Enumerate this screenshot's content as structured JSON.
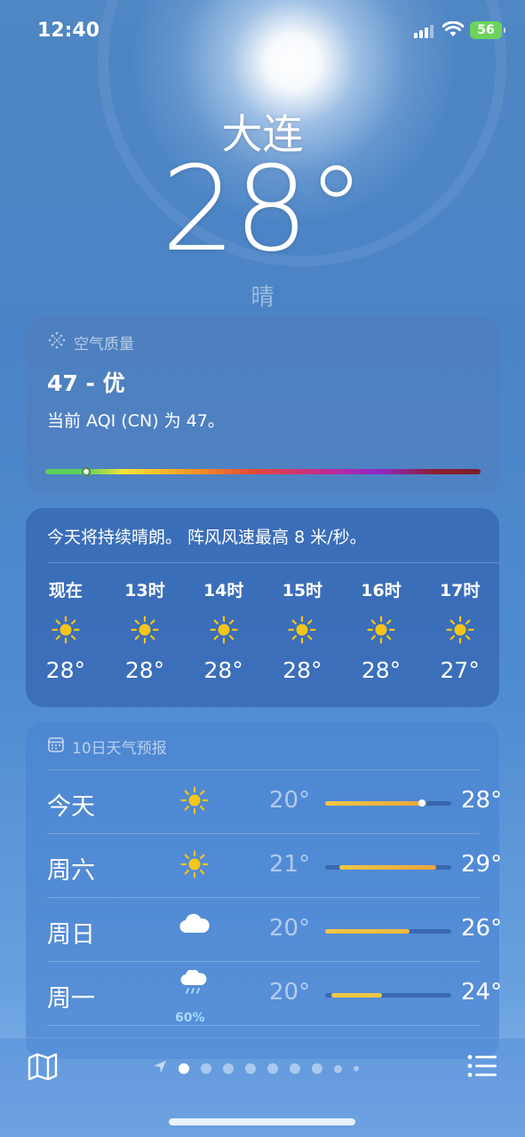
{
  "status_bar": {
    "time": "12:40",
    "battery": "56"
  },
  "location": {
    "city": "大连",
    "temperature": "28°",
    "condition": "晴"
  },
  "air_quality": {
    "header": "空气质量",
    "value": "47 - 优",
    "description": "当前 AQI (CN) 为 47。",
    "index": 47
  },
  "hourly": {
    "summary": "今天将持续晴朗。 阵风风速最高 8 米/秒。",
    "items": [
      {
        "label": "现在",
        "icon": "sun-icon",
        "temp": "28°"
      },
      {
        "label": "13时",
        "icon": "sun-icon",
        "temp": "28°"
      },
      {
        "label": "14时",
        "icon": "sun-icon",
        "temp": "28°"
      },
      {
        "label": "15时",
        "icon": "sun-icon",
        "temp": "28°"
      },
      {
        "label": "16时",
        "icon": "sun-icon",
        "temp": "28°"
      },
      {
        "label": "17时",
        "icon": "sun-icon",
        "temp": "27°"
      }
    ]
  },
  "forecast": {
    "header": "10日天气预报",
    "days": [
      {
        "day": "今天",
        "icon": "sun-icon",
        "low": "20°",
        "high": "28°",
        "precip": ""
      },
      {
        "day": "周六",
        "icon": "sun-icon",
        "low": "21°",
        "high": "29°",
        "precip": ""
      },
      {
        "day": "周日",
        "icon": "cloud-icon",
        "low": "20°",
        "high": "26°",
        "precip": ""
      },
      {
        "day": "周一",
        "icon": "cloud-rain-icon",
        "low": "20°",
        "high": "24°",
        "precip": "60%"
      }
    ]
  },
  "colors": {
    "sun": "#f5c518",
    "aqi_good": "#58d15c",
    "range_warm": "#f0a43a",
    "range_mild": "#f2c744"
  }
}
